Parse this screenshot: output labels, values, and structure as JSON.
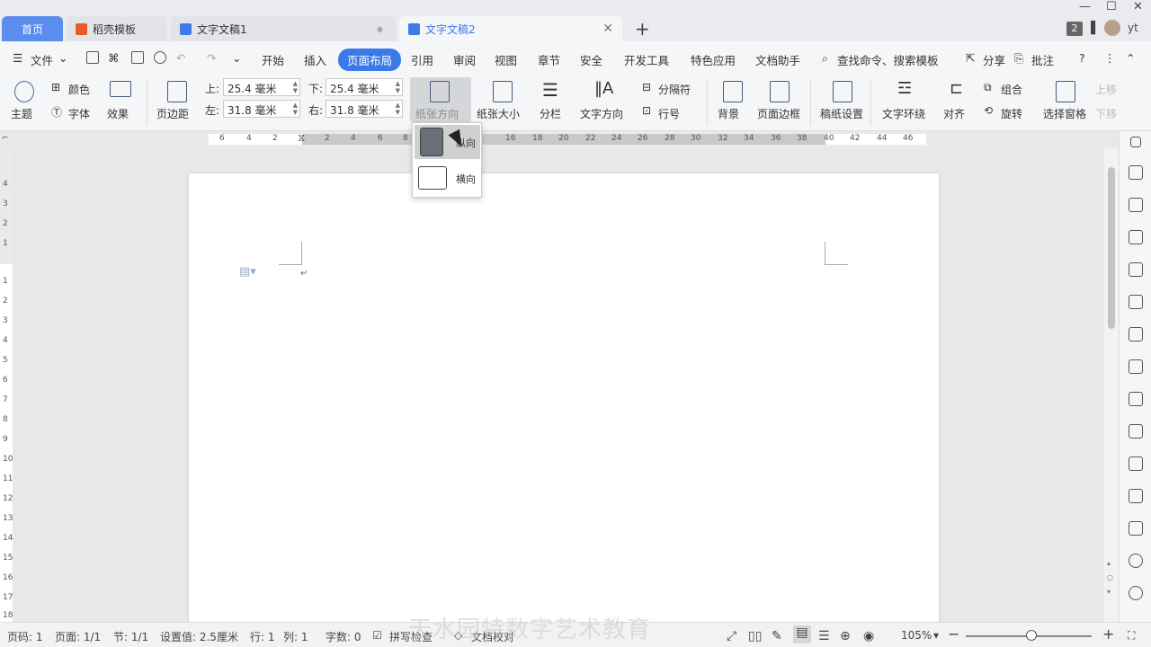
{
  "tabs": {
    "home": "首页",
    "t1": "稻壳模板",
    "t2": "文字文稿1",
    "t3": "文字文稿2",
    "badge": "2",
    "user": "yt"
  },
  "menu": {
    "file": "文件",
    "items": [
      "开始",
      "插入",
      "页面布局",
      "引用",
      "审阅",
      "视图",
      "章节",
      "安全",
      "开发工具",
      "特色应用",
      "文档助手"
    ],
    "search": "查找命令、搜索模板",
    "share": "分享",
    "comment": "批注"
  },
  "ribbon": {
    "theme": "主题",
    "color": "颜色",
    "font": "字体",
    "effect": "效果",
    "margin": "页边距",
    "top_label": "上:",
    "top_value": "25.4 毫米",
    "bottom_label": "下:",
    "bottom_value": "25.4 毫米",
    "left_label": "左:",
    "left_value": "31.8 毫米",
    "right_label": "右:",
    "right_value": "31.8 毫米",
    "orientation": "纸张方向",
    "size": "纸张大小",
    "columns": "分栏",
    "textdir": "文字方向",
    "breaks": "分隔符",
    "linenum": "行号",
    "background": "背景",
    "border": "页面边框",
    "grid": "稿纸设置",
    "wrap": "文字环绕",
    "align": "对齐",
    "group": "组合",
    "rotate": "旋转",
    "select_pane": "选择窗格",
    "up": "上移",
    "down": "下移"
  },
  "dropdown": {
    "portrait": "纵向",
    "landscape": "横向"
  },
  "ruler": {
    "h_left": [
      "6",
      "4",
      "2"
    ],
    "h_right": [
      "2",
      "4",
      "6",
      "8",
      "10",
      "12",
      "14",
      "16",
      "18",
      "20",
      "22",
      "24",
      "26",
      "28",
      "30",
      "32",
      "34",
      "36",
      "38",
      "40",
      "42",
      "44",
      "46"
    ],
    "v": [
      "4",
      "3",
      "2",
      "1",
      "1",
      "2",
      "3",
      "4",
      "5",
      "6",
      "7",
      "8",
      "9",
      "10",
      "11",
      "12",
      "13",
      "14",
      "15",
      "16",
      "17",
      "18"
    ]
  },
  "status": {
    "page_code": "页码: 1",
    "pages": "页面: 1/1",
    "section": "节: 1/1",
    "setting": "设置值: 2.5厘米",
    "row": "行: 1",
    "col": "列: 1",
    "words": "字数: 0",
    "spell": "拼写检查",
    "cert": "文档校对",
    "zoom": "105%"
  },
  "watermark": "天水园特数字艺术教育"
}
